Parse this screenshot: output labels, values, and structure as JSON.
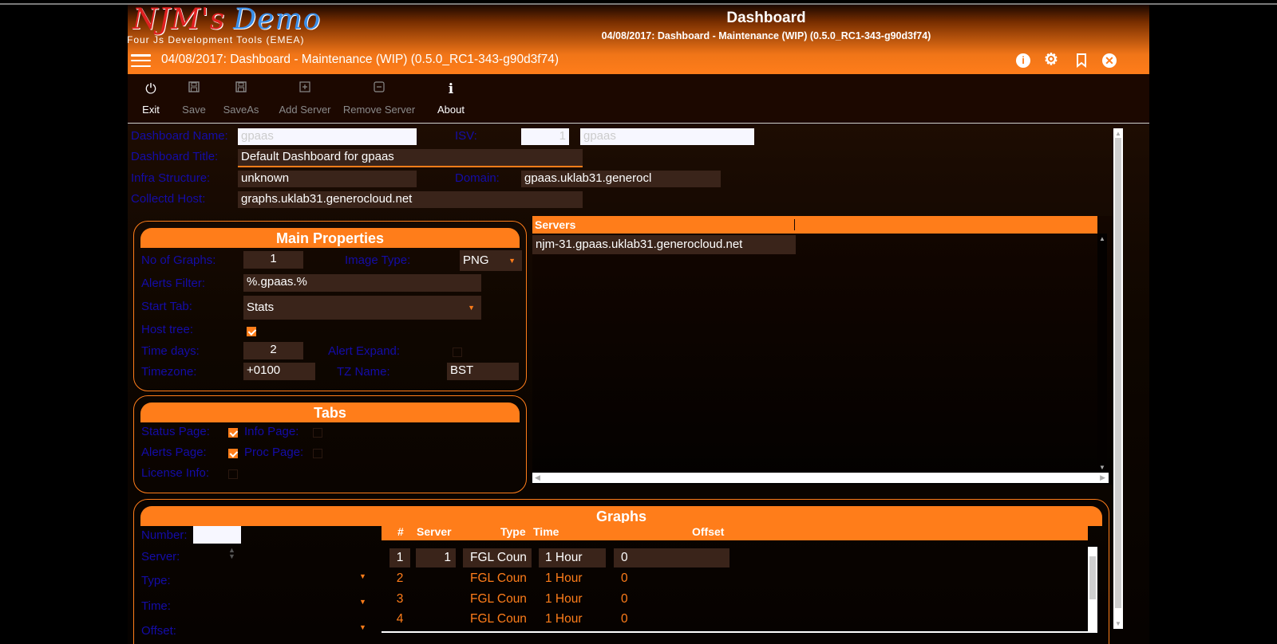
{
  "header": {
    "logo_part1": "NJM's",
    "logo_part2": "Demo",
    "logo_subtitle": "Four Js Development Tools (EMEA)",
    "title": "Dashboard",
    "subtitle": "04/08/2017: Dashboard - Maintenance (WIP) (0.5.0_RC1-343-g90d3f74)",
    "window_title": "04/08/2017: Dashboard - Maintenance (WIP) (0.5.0_RC1-343-g90d3f74)",
    "icons": [
      "menu-icon",
      "info-icon",
      "settings-icon",
      "bookmark-icon",
      "close-icon"
    ]
  },
  "toolbar": {
    "exit": "Exit",
    "save": "Save",
    "saveas": "SaveAs",
    "add_server": "Add Server",
    "remove_server": "Remove Server",
    "about": "About"
  },
  "form": {
    "dashboard_name_label": "Dashboard Name:",
    "dashboard_name": "gpaas",
    "isv_label": "ISV:",
    "isv_number": "1",
    "isv_name": "gpaas",
    "dashboard_title_label": "Dashboard Title:",
    "dashboard_title": "Default Dashboard for gpaas",
    "infra_label": "Infra Structure:",
    "infra": "unknown",
    "domain_label": "Domain:",
    "domain": "gpaas.uklab31.generocl",
    "collectd_label": "Collectd Host:",
    "collectd": "graphs.uklab31.generocloud.net"
  },
  "main_properties": {
    "title": "Main Properties",
    "no_graphs_label": "No of Graphs:",
    "no_graphs": "1",
    "image_type_label": "Image Type:",
    "image_type": "PNG",
    "alerts_filter_label": "Alerts Filter:",
    "alerts_filter": "%.gpaas.%",
    "start_tab_label": "Start Tab:",
    "start_tab": "Stats",
    "host_tree_label": "Host tree:",
    "time_days_label": "Time days:",
    "time_days": "2",
    "alert_expand_label": "Alert Expand:",
    "timezone_label": "Timezone:",
    "timezone": "+0100",
    "tz_name_label": "TZ Name:",
    "tz_name": "BST"
  },
  "tabs": {
    "title": "Tabs",
    "status_page": "Status Page:",
    "info_page": "Info Page:",
    "alerts_page": "Alerts Page:",
    "proc_page": "Proc Page:",
    "license_info": "License Info:"
  },
  "servers": {
    "header": "Servers",
    "rows": [
      "njm-31.gpaas.uklab31.generocloud.net"
    ]
  },
  "graphs": {
    "title": "Graphs",
    "number_label": "Number:",
    "server_label": "Server:",
    "type_label": "Type:",
    "time_label": "Time:",
    "offset_label": "Offset:",
    "columns": [
      "#",
      "Server",
      "Type",
      "Time",
      "Offset"
    ],
    "rows": [
      {
        "num": "1",
        "server": "1",
        "type": "FGL Coun",
        "time": "1 Hour",
        "offset": "0"
      },
      {
        "num": "2",
        "server": "",
        "type": "FGL Coun",
        "time": "1 Hour",
        "offset": "0"
      },
      {
        "num": "3",
        "server": "",
        "type": "FGL Coun",
        "time": "1 Hour",
        "offset": "0"
      },
      {
        "num": "4",
        "server": "",
        "type": "FGL Coun",
        "time": "1 Hour",
        "offset": "0"
      }
    ]
  },
  "colors": {
    "accent": "#ff7d1a",
    "label": "#140ca8",
    "field_bg": "#3a241a"
  }
}
